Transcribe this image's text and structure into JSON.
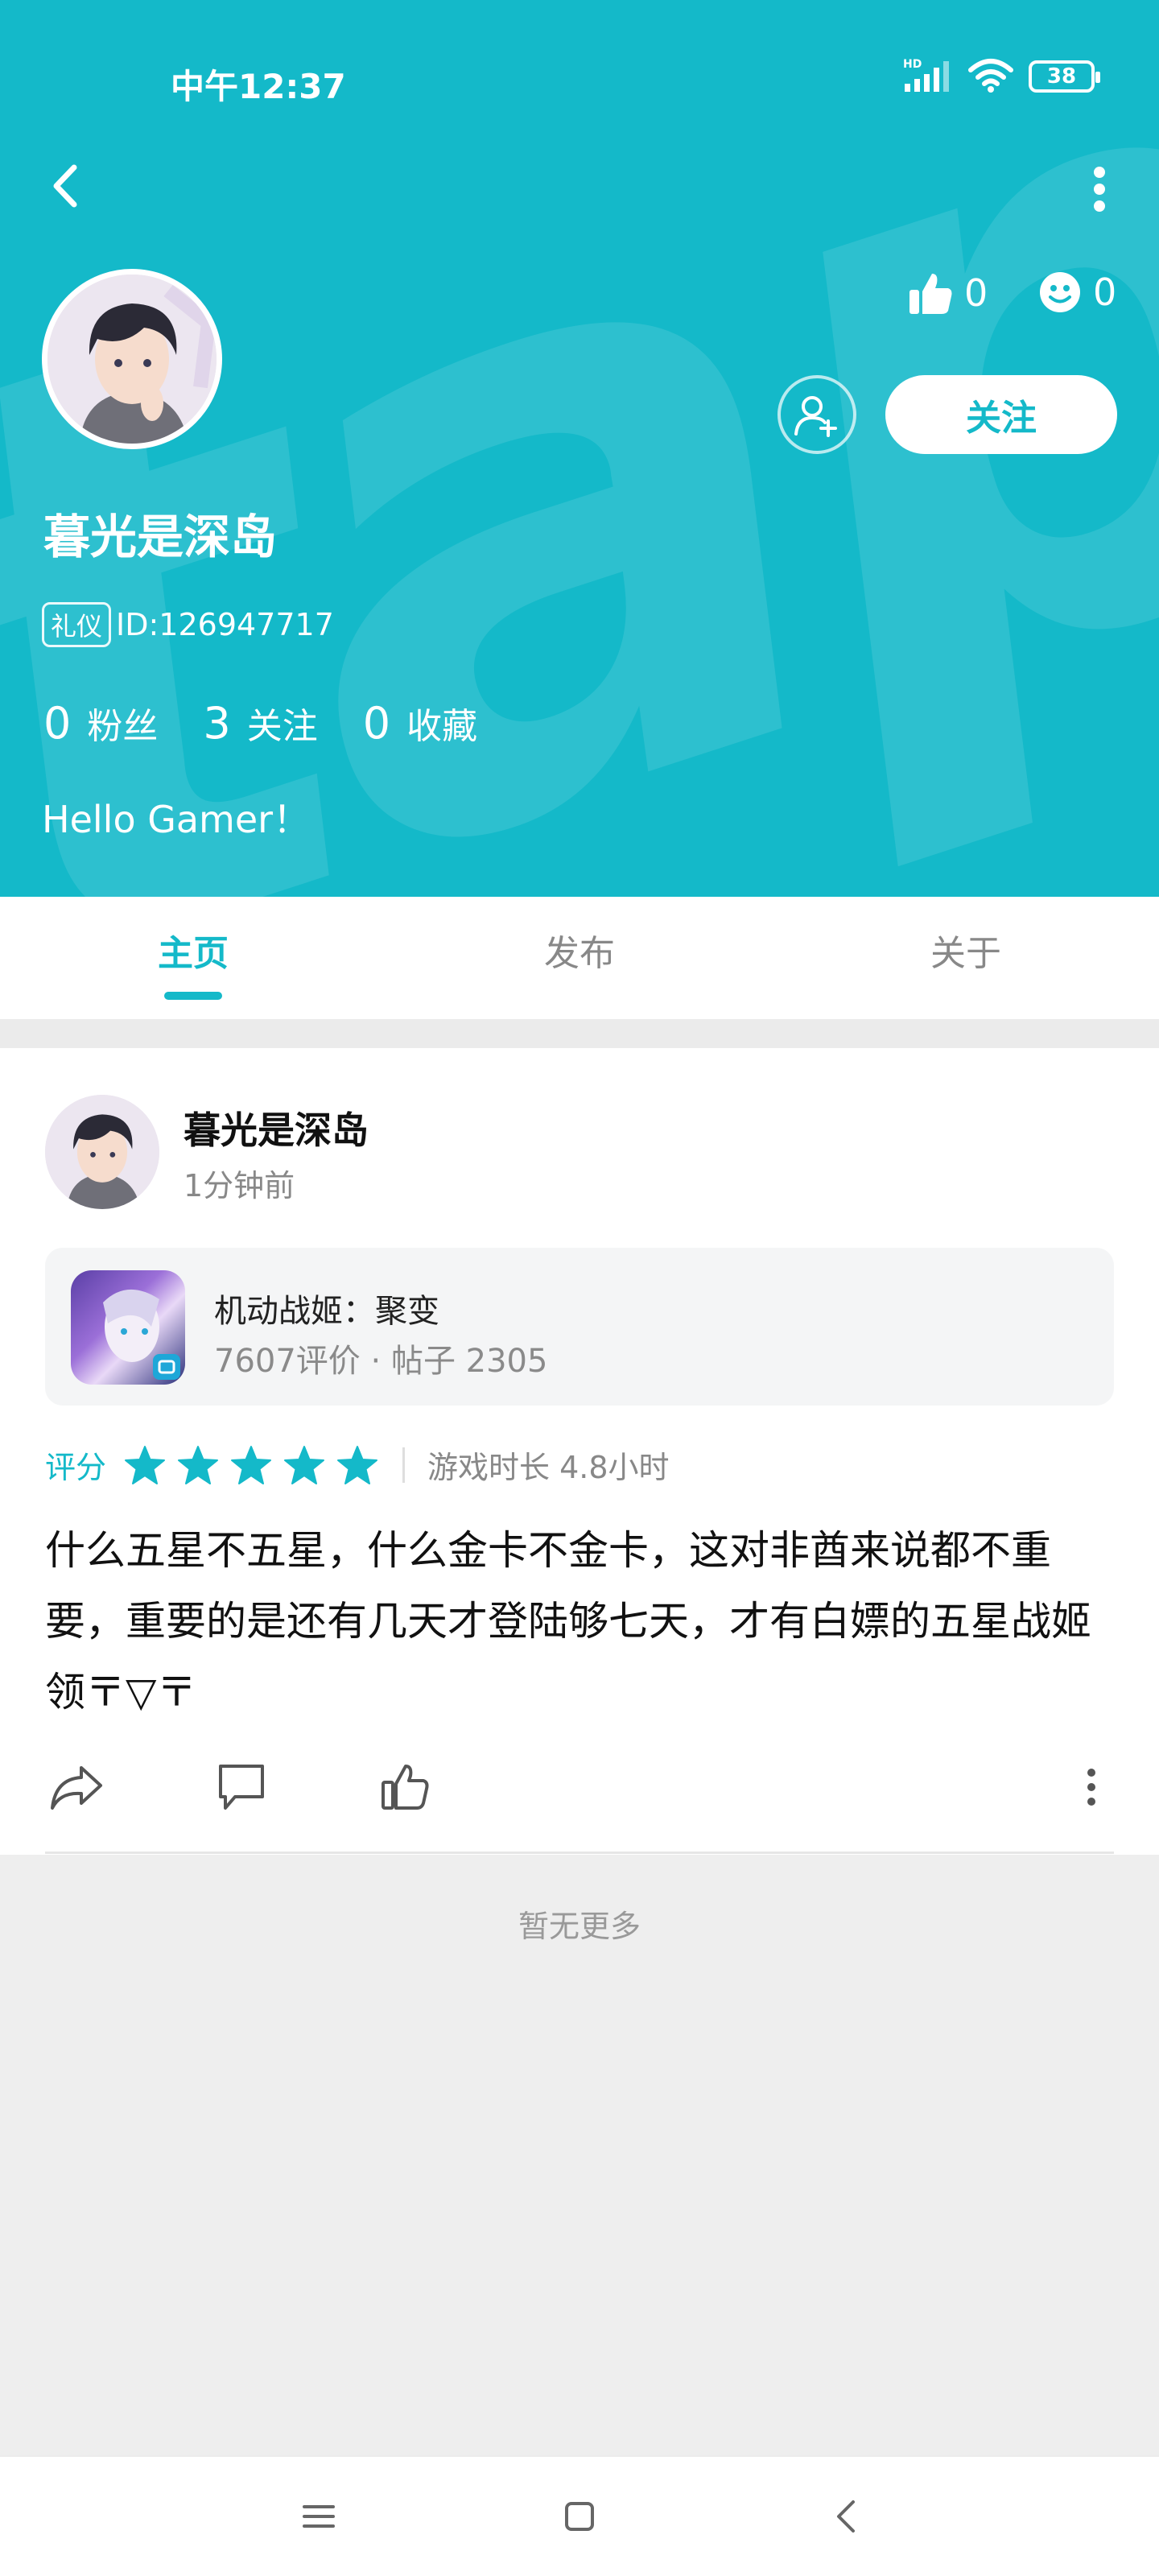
{
  "status_bar": {
    "time": "中午12:37",
    "network_label": "HD",
    "battery": "38"
  },
  "profile": {
    "likes": "0",
    "smiles": "0",
    "follow_label": "关注",
    "name": "暮光是深岛",
    "badge": "礼仪",
    "id_text": "ID:126947717",
    "fans_count": "0",
    "fans_label": "粉丝",
    "following_count": "3",
    "following_label": "关注",
    "favorites_count": "0",
    "favorites_label": "收藏",
    "bio": "Hello Gamer！"
  },
  "tabs": [
    {
      "label": "主页",
      "active": true
    },
    {
      "label": "发布",
      "active": false
    },
    {
      "label": "关于",
      "active": false
    }
  ],
  "post": {
    "user": "暮光是深岛",
    "time": "1分钟前",
    "game": {
      "name": "机动战姬：聚变",
      "meta": "7607评价  ·  帖子 2305"
    },
    "rating_label": "评分",
    "stars": 5,
    "playtime": "游戏时长 4.8小时",
    "body": "什么五星不五星，什么金卡不金卡，这对非酋来说都不重要，重要的是还有几天才登陆够七天，才有白嫖的五星战姬领〒▽〒"
  },
  "footer": {
    "no_more": "暂无更多"
  },
  "colors": {
    "brand": "#14b9c9",
    "header_bg": "#14b9c9"
  }
}
